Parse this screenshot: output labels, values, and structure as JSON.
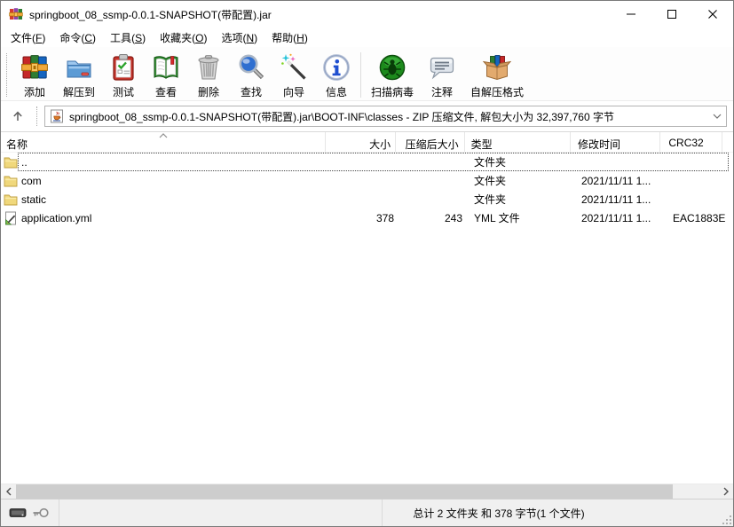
{
  "window": {
    "title": "springboot_08_ssmp-0.0.1-SNAPSHOT(带配置).jar",
    "controls": [
      "minimize",
      "maximize",
      "close"
    ]
  },
  "menu": {
    "items": [
      {
        "label": "文件",
        "key": "F"
      },
      {
        "label": "命令",
        "key": "C"
      },
      {
        "label": "工具",
        "key": "S"
      },
      {
        "label": "收藏夹",
        "key": "O"
      },
      {
        "label": "选项",
        "key": "N"
      },
      {
        "label": "帮助",
        "key": "H"
      }
    ]
  },
  "toolbar": {
    "buttons": [
      {
        "name": "add",
        "icon": "add",
        "label": "添加"
      },
      {
        "name": "extract-to",
        "icon": "extract",
        "label": "解压到"
      },
      {
        "name": "test",
        "icon": "test",
        "label": "测试"
      },
      {
        "name": "view",
        "icon": "view",
        "label": "查看"
      },
      {
        "name": "delete",
        "icon": "delete",
        "label": "删除"
      },
      {
        "name": "find",
        "icon": "find",
        "label": "查找"
      },
      {
        "name": "wizard",
        "icon": "wizard",
        "label": "向导"
      },
      {
        "name": "info",
        "icon": "info",
        "label": "信息"
      },
      {
        "name": "virus-scan",
        "icon": "virus",
        "label": "扫描病毒",
        "separator_before": true
      },
      {
        "name": "comment",
        "icon": "comment",
        "label": "注释"
      },
      {
        "name": "sfx",
        "icon": "sfx",
        "label": "自解压格式"
      }
    ]
  },
  "addressbar": {
    "path": "springboot_08_ssmp-0.0.1-SNAPSHOT(带配置).jar\\BOOT-INF\\classes - ZIP 压缩文件, 解包大小为 32,397,760 字节"
  },
  "filelist": {
    "columns": {
      "name": "名称",
      "size": "大小",
      "packed": "压缩后大小",
      "type": "类型",
      "modified": "修改时间",
      "crc": "CRC32"
    },
    "sort": {
      "column": "name",
      "direction": "ascending"
    },
    "rows": [
      {
        "name": "..",
        "icon": "folder",
        "size": "",
        "packed": "",
        "type": "文件夹",
        "modified": "",
        "crc": "",
        "focused": true
      },
      {
        "name": "com",
        "icon": "folder",
        "size": "",
        "packed": "",
        "type": "文件夹",
        "modified": "2021/11/11 1...",
        "crc": ""
      },
      {
        "name": "static",
        "icon": "folder",
        "size": "",
        "packed": "",
        "type": "文件夹",
        "modified": "2021/11/11 1...",
        "crc": ""
      },
      {
        "name": "application.yml",
        "icon": "yml",
        "size": "378",
        "packed": "243",
        "type": "YML 文件",
        "modified": "2021/11/11 1...",
        "crc": "EAC1883E"
      }
    ]
  },
  "statusbar": {
    "total": "总计 2 文件夹 和 378 字节(1 个文件)"
  },
  "colors": {
    "folder_yellow": "#f0d87c",
    "statusbar_bg": "#f0f0f0",
    "window_border": "#7a7a7a",
    "lens_blue": "#2f6fd0",
    "virus_green": "#1c8a1c",
    "archive_red": "#c62828"
  }
}
